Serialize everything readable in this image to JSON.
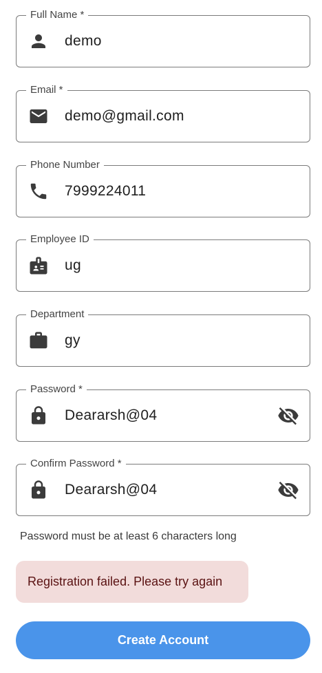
{
  "form": {
    "full_name": {
      "label": "Full Name *",
      "value": "demo",
      "icon": "person-icon"
    },
    "email": {
      "label": "Email *",
      "value": "demo@gmail.com",
      "icon": "mail-icon"
    },
    "phone": {
      "label": "Phone Number",
      "value": "7999224011",
      "icon": "phone-icon"
    },
    "employee_id": {
      "label": "Employee ID",
      "value": "ug",
      "icon": "badge-icon"
    },
    "department": {
      "label": "Department",
      "value": "gy",
      "icon": "briefcase-icon"
    },
    "password": {
      "label": "Password *",
      "value": "Deararsh@04",
      "icon": "lock-icon",
      "toggle_icon": "visibility-off-icon"
    },
    "confirm_password": {
      "label": "Confirm Password *",
      "value": "Deararsh@04",
      "icon": "lock-icon",
      "toggle_icon": "visibility-off-icon"
    }
  },
  "helper_text": "Password must be at least 6 characters long",
  "error_message": "Registration failed. Please try again",
  "submit": {
    "label": "Create Account"
  },
  "colors": {
    "primary": "#4a94ea",
    "error_bg": "#f2dcdb",
    "error_text": "#5a1212",
    "border": "#7a7a7a"
  }
}
